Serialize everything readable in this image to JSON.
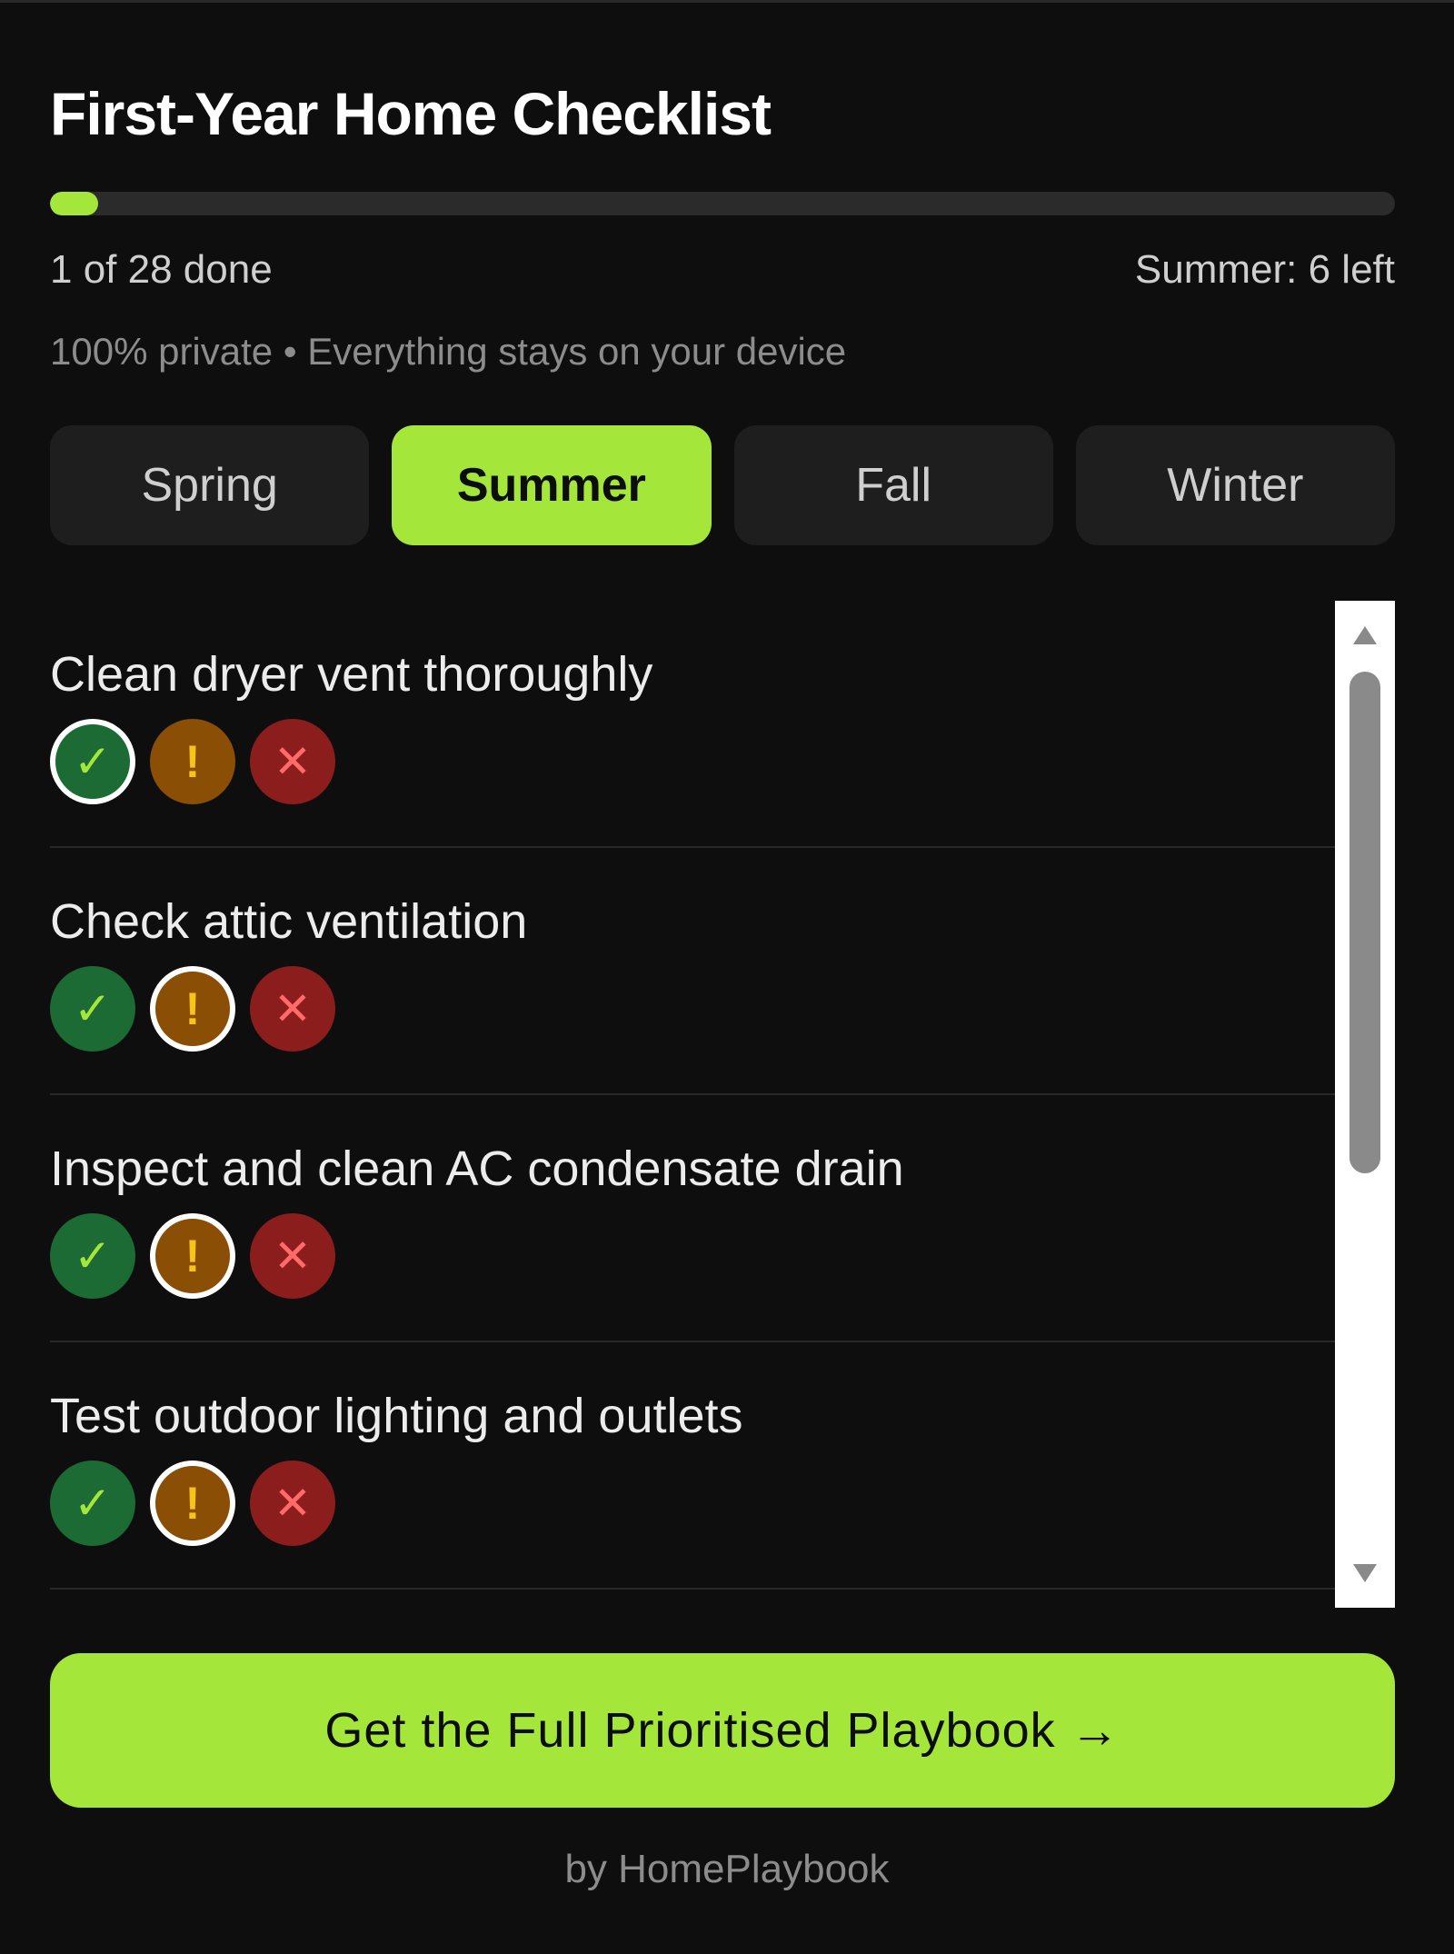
{
  "header": {
    "title": "First-Year Home Checklist",
    "progress": {
      "done": 1,
      "total": 28,
      "fraction": 0.036
    },
    "done_text": "1 of 28 done",
    "season_left_text": "Summer: 6 left",
    "privacy_text": "100% private • Everything stays on your device"
  },
  "tabs": [
    {
      "label": "Spring",
      "active": false
    },
    {
      "label": "Summer",
      "active": true
    },
    {
      "label": "Fall",
      "active": false
    },
    {
      "label": "Winter",
      "active": false
    }
  ],
  "status_icons": {
    "done": "✓",
    "warn": "!",
    "fail": "✕"
  },
  "tasks": [
    {
      "title": "Clean dryer vent thoroughly",
      "status": "done"
    },
    {
      "title": "Check attic ventilation",
      "status": "warn"
    },
    {
      "title": "Inspect and clean AC condensate drain",
      "status": "warn"
    },
    {
      "title": "Test outdoor lighting and outlets",
      "status": "warn"
    }
  ],
  "cta": {
    "label": "Get the Full Prioritised Playbook →"
  },
  "footer": {
    "text": "by HomePlaybook"
  },
  "colors": {
    "accent": "#a4e63a",
    "done": "#1c6b35",
    "warn": "#8a4e05",
    "fail": "#8c1d1d",
    "background": "#0e0e0e"
  }
}
